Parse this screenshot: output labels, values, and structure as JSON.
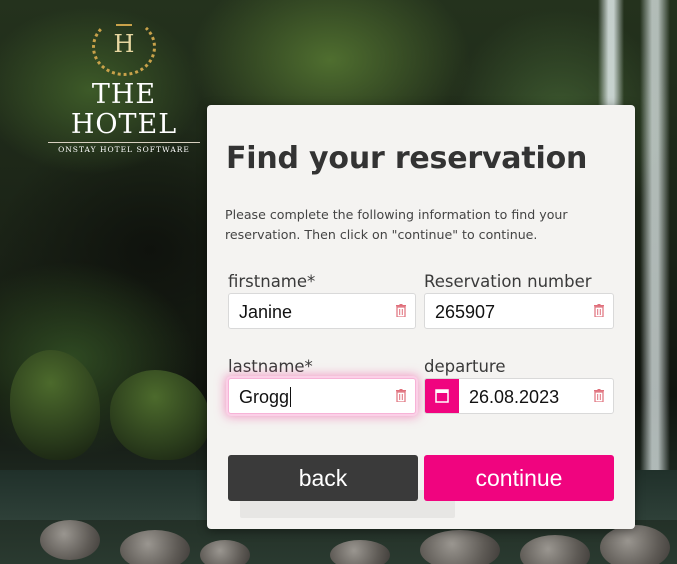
{
  "brand": {
    "crest_letter": "H",
    "name": "THE HOTEL",
    "tagline": "ONSTAY HOTEL SOFTWARE"
  },
  "form": {
    "title": "Find your reservation",
    "intro": "Please complete the following information to find your reservation. Then click on \"continue\" to continue.",
    "firstname": {
      "label": "firstname*",
      "value": "Janine"
    },
    "reservation_number": {
      "label": "Reservation number",
      "value": "265907"
    },
    "lastname": {
      "label": "lastname*",
      "value": "Grogg"
    },
    "departure": {
      "label": "departure",
      "value": "26.08.2023"
    }
  },
  "actions": {
    "back_label": "back",
    "continue_label": "continue"
  },
  "colors": {
    "accent": "#f0047f",
    "back_button": "#3a3a3a",
    "card_bg": "#f4f3f1",
    "trash_icon": "#e0707c",
    "logo_gold": "#c9a24a"
  }
}
